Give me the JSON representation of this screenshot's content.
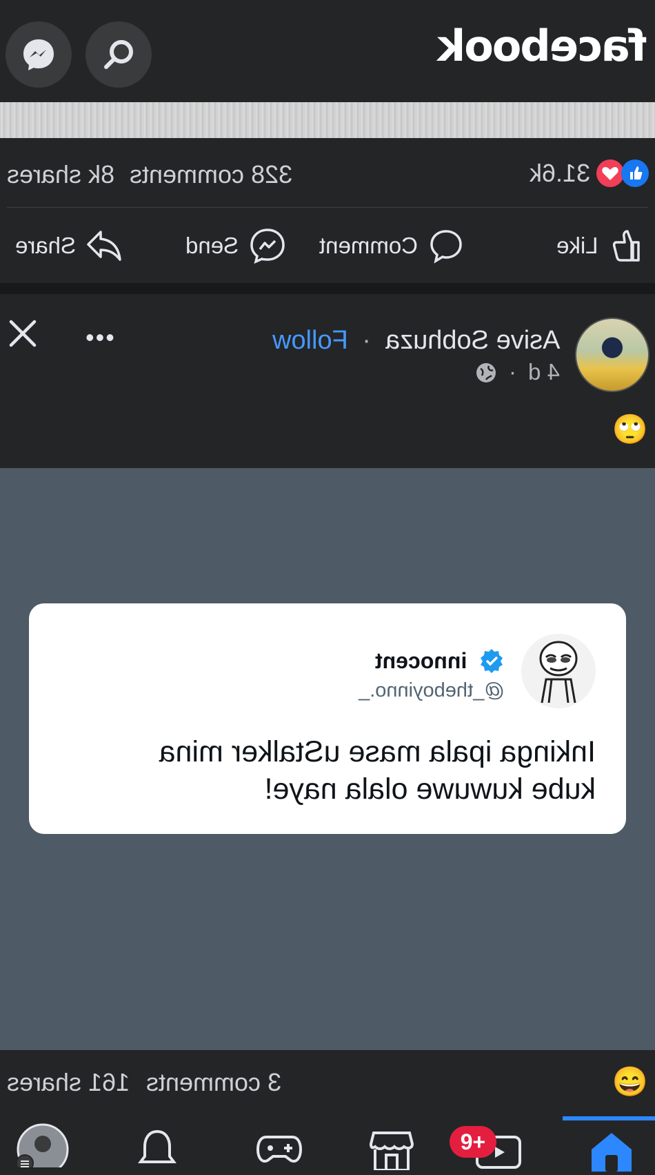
{
  "header": {
    "logo_text": "facebook",
    "messenger_icon": "messenger-icon",
    "search_icon": "search-icon"
  },
  "previous_post": {
    "reaction_count": "31.6k",
    "comments": "328 comments",
    "shares": "8k shares",
    "actions": {
      "like": "Like",
      "comment": "Comment",
      "send": "Send",
      "share": "Share"
    }
  },
  "post": {
    "author": "Asive Sobhuza",
    "separator": "·",
    "follow_label": "Follow",
    "time": "4 d",
    "meta_sep": "·",
    "caption_emoji": "🙄",
    "more_label": "•••",
    "tweet": {
      "name": "innocent",
      "handle": "@_theboyinno._",
      "text": "Inkinga ipala mase uStalker mina kube kuwuwe olala naye!"
    },
    "reaction_emoji": "😄",
    "comments": "3 comments",
    "shares": "161 shares"
  },
  "bottom_nav": {
    "badge": "9+",
    "items": [
      "home-icon",
      "video-icon",
      "marketplace-icon",
      "gaming-icon",
      "notifications-icon",
      "profile-menu"
    ]
  },
  "colors": {
    "background": "#242527",
    "accent": "#2d88ff",
    "follow": "#4599ff",
    "badge": "#e41e3f",
    "image_bg": "#4e5a65"
  }
}
